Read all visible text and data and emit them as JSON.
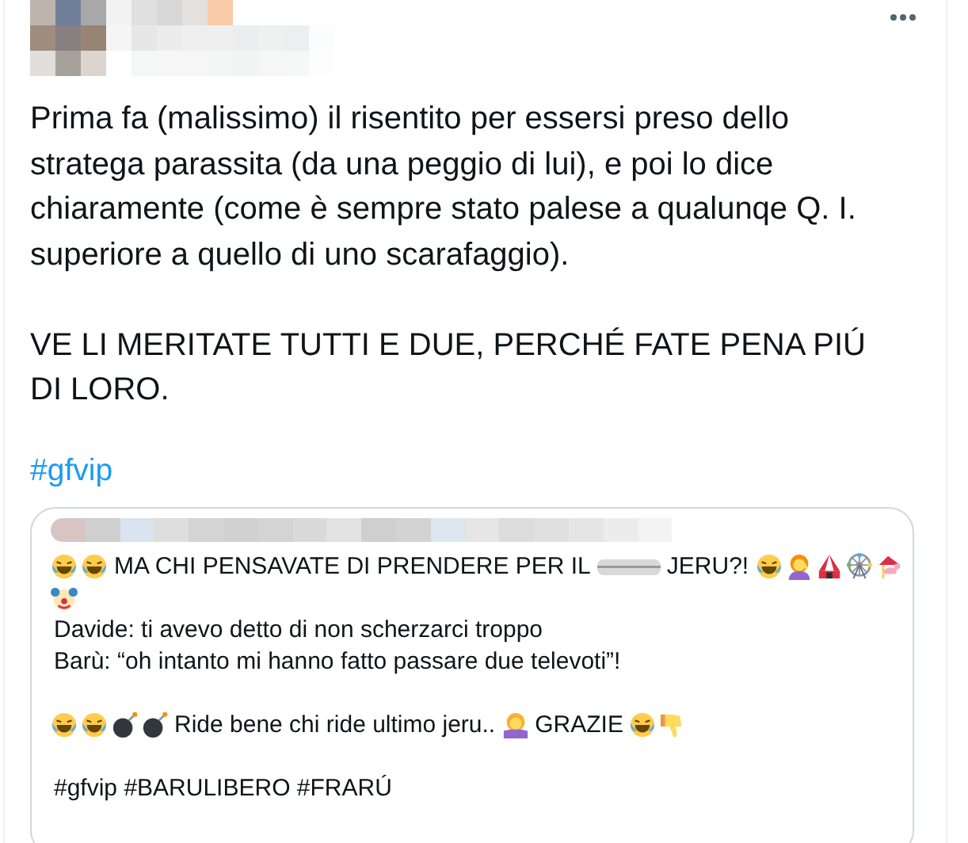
{
  "tweet": {
    "paragraphs": [
      "Prima fa (malissimo) il risentito per essersi preso dello stratega parassita (da una peggio di lui), e poi lo dice chiaramente (come è sempre stato palese a qualunqe Q. I. superiore a quello di uno scarafaggio).",
      "VE LI MERITATE TUTTI E DUE, PERCHÉ FATE PENA PIÚ DI LORO."
    ],
    "hashtag": "#gfvip",
    "quote": {
      "paragraphs": [
        [
          [
            {
              "kind": "laugh"
            },
            {
              "kind": "laugh"
            },
            {
              "kind": "text",
              "text": "MA CHI PENSAVATE DI PRENDERE PER IL"
            },
            {
              "kind": "blur"
            },
            {
              "kind": "text",
              "text": "JERU?!"
            },
            {
              "kind": "laugh"
            },
            {
              "kind": "facepalm"
            },
            {
              "kind": "tent"
            },
            {
              "kind": "wheel"
            },
            {
              "kind": "carousel"
            }
          ],
          [
            {
              "kind": "clown"
            }
          ],
          [
            {
              "kind": "text",
              "text": "Davide: ti avevo detto di non scherzarci troppo"
            }
          ],
          [
            {
              "kind": "text",
              "text": "Barù: “oh intanto mi hanno fatto passare due televoti”!"
            }
          ]
        ],
        [
          [
            {
              "kind": "laugh"
            },
            {
              "kind": "laugh"
            },
            {
              "kind": "bomb"
            },
            {
              "kind": "bomb"
            },
            {
              "kind": "text",
              "text": "Ride bene chi ride ultimo jeru.."
            },
            {
              "kind": "shrug"
            },
            {
              "kind": "text",
              "text": "GRAZIE"
            },
            {
              "kind": "laugh"
            },
            {
              "kind": "thumbsdown"
            }
          ]
        ],
        [
          [
            {
              "kind": "text",
              "text": "#gfvip #BARULIBERO #FRARÚ"
            }
          ]
        ]
      ]
    }
  }
}
